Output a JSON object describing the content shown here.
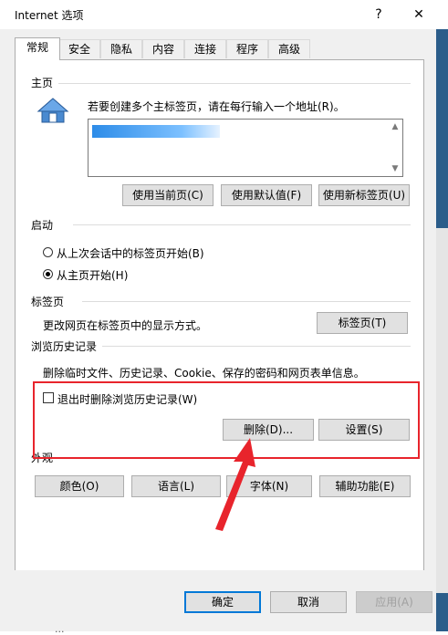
{
  "window": {
    "title": "Internet 选项",
    "help_glyph": "?",
    "close_glyph": "✕"
  },
  "tabs": [
    "常规",
    "安全",
    "隐私",
    "内容",
    "连接",
    "程序",
    "高级"
  ],
  "homepage": {
    "section": "主页",
    "description": "若要创建多个主标签页，请在每行输入一个地址(R)。",
    "url_value": "",
    "buttons": {
      "use_current": "使用当前页(C)",
      "use_default": "使用默认值(F)",
      "use_new_tab": "使用新标签页(U)"
    }
  },
  "startup": {
    "section": "启动",
    "option1": "从上次会话中的标签页开始(B)",
    "option2": "从主页开始(H)",
    "selected": 2
  },
  "tabs_section": {
    "section": "标签页",
    "description": "更改网页在标签页中的显示方式。",
    "button": "标签页(T)"
  },
  "history": {
    "section": "浏览历史记录",
    "description": "删除临时文件、历史记录、Cookie、保存的密码和网页表单信息。",
    "checkbox_label": "退出时删除浏览历史记录(W)",
    "checkbox_checked": false,
    "delete_button": "删除(D)...",
    "settings_button": "设置(S)"
  },
  "appearance": {
    "section": "外观",
    "colors": "颜色(O)",
    "languages": "语言(L)",
    "fonts": "字体(N)",
    "accessibility": "辅助功能(E)"
  },
  "footer": {
    "ok": "确定",
    "cancel": "取消",
    "apply": "应用(A)"
  },
  "background_text": "...",
  "colors": {
    "highlight_red": "#e8242c",
    "accent_blue": "#0078d7"
  }
}
